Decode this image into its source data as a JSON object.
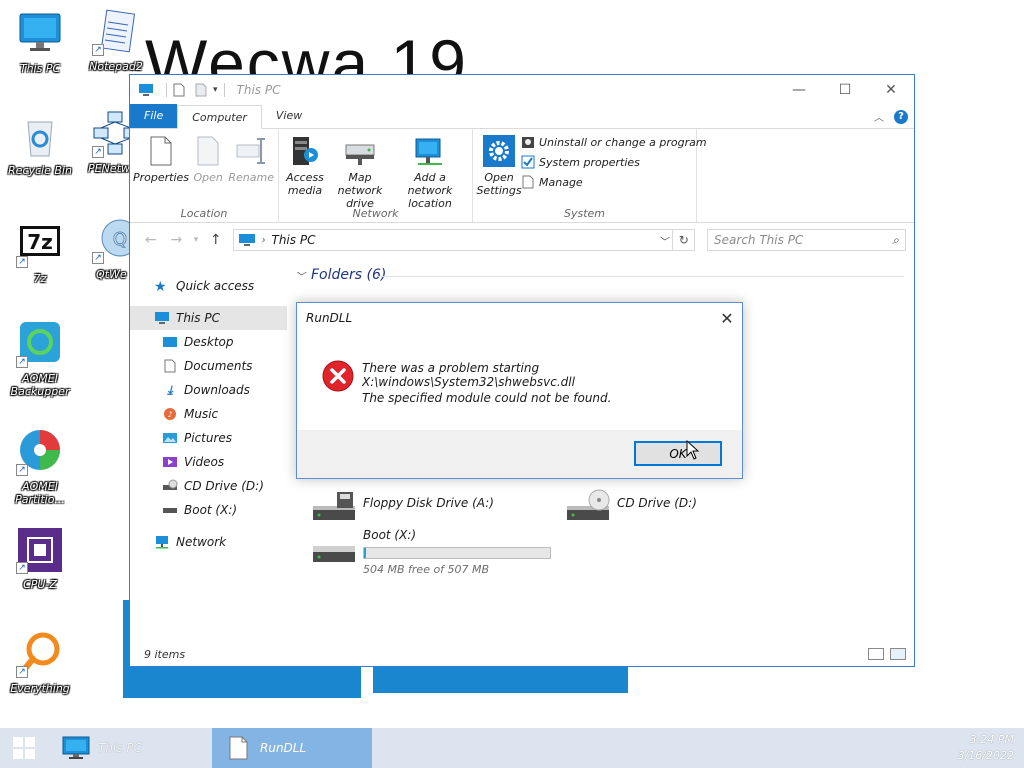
{
  "wallpaper": {
    "title": "Wecwa 19"
  },
  "desktop_icons": [
    {
      "label": "This PC"
    },
    {
      "label": "Notepad2"
    },
    {
      "label": "Recycle Bin"
    },
    {
      "label": "PENetw"
    },
    {
      "label": "7z"
    },
    {
      "label": "QtWe"
    },
    {
      "label": "AOMEI Backupper"
    },
    {
      "label": "AOMEI Partitio..."
    },
    {
      "label": "CPU-Z"
    },
    {
      "label": "Everything"
    }
  ],
  "explorer": {
    "title": "This PC",
    "tabs": {
      "file": "File",
      "computer": "Computer",
      "view": "View"
    },
    "ribbon": {
      "location": {
        "name": "Location",
        "properties": "Properties",
        "open": "Open",
        "rename": "Rename"
      },
      "network": {
        "name": "Network",
        "access_media": "Access media",
        "map_drive": "Map network drive",
        "add_location": "Add a network location"
      },
      "system": {
        "name": "System",
        "open_settings": "Open Settings",
        "uninstall": "Uninstall or change a program",
        "system_properties": "System properties",
        "manage": "Manage"
      }
    },
    "address": "This PC",
    "search_placeholder": "Search This PC",
    "nav": {
      "quick_access": "Quick access",
      "this_pc": "This PC",
      "desktop": "Desktop",
      "documents": "Documents",
      "downloads": "Downloads",
      "music": "Music",
      "pictures": "Pictures",
      "videos": "Videos",
      "cd_drive": "CD Drive (D:)",
      "boot": "Boot (X:)",
      "network": "Network"
    },
    "folders_header": "Folders (6)",
    "drives": {
      "floppy": "Floppy Disk Drive (A:)",
      "cd": "CD Drive (D:)",
      "boot_name": "Boot (X:)",
      "boot_free": "504 MB free of 507 MB",
      "boot_used_fraction": 0.01
    },
    "status": "9 items"
  },
  "dialog": {
    "title": "RunDLL",
    "message1": "There was a problem starting X:\\windows\\System32\\shwebsvc.dll",
    "message2": "The specified module could not be found.",
    "ok": "OK"
  },
  "taskbar": {
    "items": {
      "this_pc": "This PC",
      "rundll": "RunDLL"
    },
    "time": "3:24 PM",
    "date": "3/16/2022"
  },
  "colors": {
    "accent": "#1979ca",
    "wallpaper_blue": "#1a86d0",
    "error_red": "#e0242a",
    "taskbar": "#dbe4ef"
  }
}
